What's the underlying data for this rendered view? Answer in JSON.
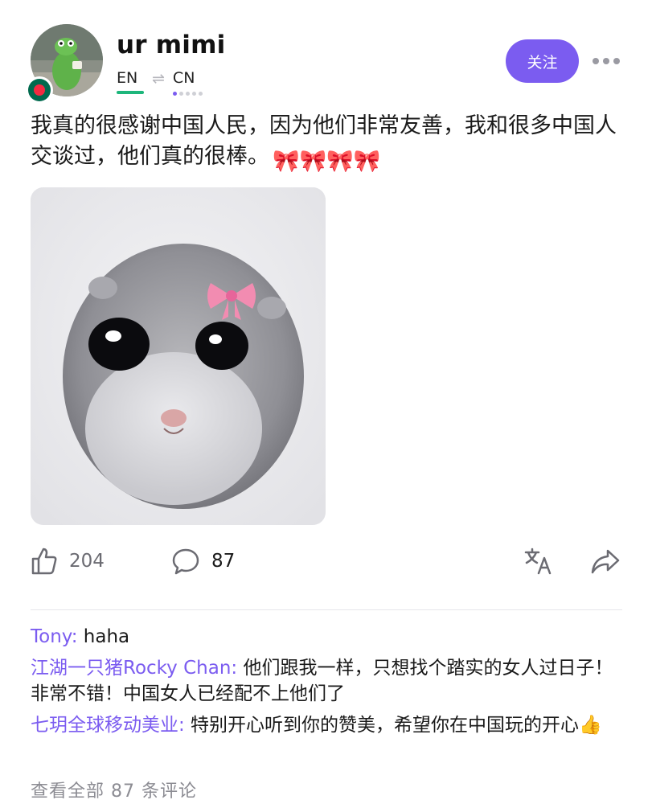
{
  "user": {
    "name": "ur mimi",
    "languages": {
      "from": "EN",
      "to": "CN"
    },
    "follow_label": "关注"
  },
  "post": {
    "text": "我真的很感谢中国人民，因为他们非常友善，我和很多中国人交谈过，他们真的很棒。",
    "emojis": "🎀🎀🎀🎀"
  },
  "stats": {
    "likes": "204",
    "comments": "87"
  },
  "comments": [
    {
      "author": "Tony:",
      "text": " haha"
    },
    {
      "author": "江湖一只猪Rocky Chan:",
      "text": " 他们跟我一样，只想找个踏实的女人过日子！非常不错！中国女人已经配不上他们了"
    },
    {
      "author": "七玥全球移动美业:",
      "text": " 特别开心听到你的赞美，希望你在中国玩的开心👍"
    }
  ],
  "view_all": "查看全部 87 条评论",
  "colors": {
    "accent": "#7b5cf0",
    "lang_bar": "#1db67b",
    "muted": "#6b6b72"
  }
}
